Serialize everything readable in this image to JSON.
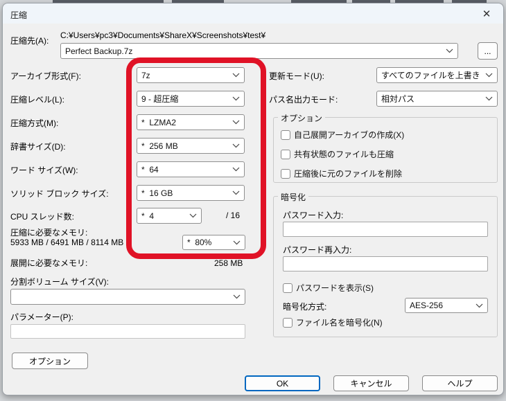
{
  "window": {
    "title": "圧縮",
    "close_icon": "✕"
  },
  "destination": {
    "label": "圧縮先(A):",
    "path": "C:¥Users¥pc3¥Documents¥ShareX¥Screenshots¥test¥",
    "filename": "Perfect Backup.7z",
    "browse_label": "..."
  },
  "left_fields": [
    {
      "label": "アーカイブ形式(F):",
      "value": "7z"
    },
    {
      "label": "圧縮レベル(L):",
      "value": "9 - 超圧縮"
    },
    {
      "label": "圧縮方式(M):",
      "value": "*  LZMA2"
    },
    {
      "label": "辞書サイズ(D):",
      "value": "*  256 MB"
    },
    {
      "label": "ワード サイズ(W):",
      "value": "*  64"
    },
    {
      "label": "ソリッド ブロック サイズ:",
      "value": "*  16 GB"
    },
    {
      "label": "CPU スレッド数:",
      "value": "*  4",
      "suffix": "/ 16"
    }
  ],
  "memory_compress": {
    "label": "圧縮に必要なメモリ:",
    "values": "5933 MB / 6491 MB / 8114 MB",
    "percent": "*  80%"
  },
  "memory_decompress": {
    "label": "展開に必要なメモリ:",
    "value": "258 MB"
  },
  "split_volume": {
    "label": "分割ボリューム サイズ(V):",
    "value": ""
  },
  "parameters": {
    "label": "パラメーター(P):",
    "value": ""
  },
  "options_button_label": "オプション",
  "right_fields": [
    {
      "label": "更新モード(U):",
      "value": "すべてのファイルを上書き"
    },
    {
      "label": "パス名出力モード:",
      "value": "相対パス"
    }
  ],
  "options_group": {
    "title": "オプション",
    "checkboxes": [
      "自己展開アーカイブの作成(X)",
      "共有状態のファイルも圧縮",
      "圧縮後に元のファイルを削除"
    ]
  },
  "encryption_group": {
    "title": "暗号化",
    "password_label": "パスワード入力:",
    "password_value": "",
    "password_repeat_label": "パスワード再入力:",
    "password_repeat_value": "",
    "show_password_label": "パスワードを表示(S)",
    "method_label": "暗号化方式:",
    "method_value": "AES-256",
    "encrypt_names_label": "ファイル名を暗号化(N)"
  },
  "footer": {
    "ok": "OK",
    "cancel": "キャンセル",
    "help": "ヘルプ"
  },
  "annotation_color": "#e01226"
}
